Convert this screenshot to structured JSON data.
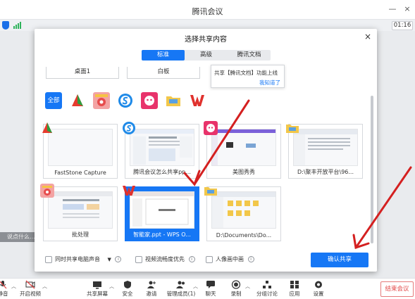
{
  "window": {
    "title": "腾讯会议",
    "min_glyph": "—",
    "close_glyph": "×"
  },
  "status": {
    "timer": "01:16"
  },
  "remarks": "说点什么…",
  "dialog": {
    "title": "选择共享内容",
    "close_glyph": "×",
    "tabs": [
      {
        "label": "标准",
        "active": true
      },
      {
        "label": "高级",
        "active": false
      },
      {
        "label": "腾讯文档",
        "active": false
      }
    ],
    "top_cards": [
      "桌面1",
      "白板"
    ],
    "tooltip": {
      "text": "共享【腾讯文档】功能上线",
      "link": "我知道了"
    },
    "filter_all": "全部",
    "filter_icons": [
      "faststone-icon",
      "batch-tool-icon",
      "sogou-icon",
      "meitu-icon",
      "folder-icon",
      "wps-icon"
    ],
    "tiles": [
      {
        "label": "FastStone Capture",
        "selected": false,
        "badge": "faststone-icon"
      },
      {
        "label": "腾讯会议怎么共享pp...",
        "selected": false,
        "badge": "sogou-icon"
      },
      {
        "label": "美图秀秀",
        "selected": false,
        "badge": "meitu-icon"
      },
      {
        "label": "D:\\聚丰开放平台\\96...",
        "selected": false,
        "badge": "folder-icon"
      },
      {
        "label": "批处理",
        "selected": false,
        "badge": "batch-tool-icon"
      },
      {
        "label": "智能家.ppt - WPS O...",
        "selected": true,
        "badge": "wps-icon"
      },
      {
        "label": "D:\\Documents\\Do...",
        "selected": false,
        "badge": "folder-icon"
      }
    ],
    "options": {
      "share_audio": "同时共享电脑声音",
      "smooth_video": "视频流畅度优先",
      "pip": "人像画中画"
    },
    "confirm": "确认共享"
  },
  "toolbar": {
    "items": [
      {
        "label": "静音",
        "icon": "mic-icon"
      },
      {
        "label": "开启视频",
        "icon": "camera-off-icon"
      },
      {
        "label": "共享屏幕",
        "icon": "share-screen-icon"
      },
      {
        "label": "安全",
        "icon": "shield-icon"
      },
      {
        "label": "邀请",
        "icon": "invite-icon"
      },
      {
        "label": "管理成员(1)",
        "icon": "members-icon"
      },
      {
        "label": "聊天",
        "icon": "chat-icon"
      },
      {
        "label": "录制",
        "icon": "record-icon"
      },
      {
        "label": "分组讨论",
        "icon": "breakout-icon"
      },
      {
        "label": "应用",
        "icon": "apps-icon"
      },
      {
        "label": "设置",
        "icon": "gear-icon"
      }
    ],
    "end": "结束会议"
  },
  "colors": {
    "accent": "#1677f5",
    "annotation": "#d42020",
    "danger": "#e34949"
  }
}
